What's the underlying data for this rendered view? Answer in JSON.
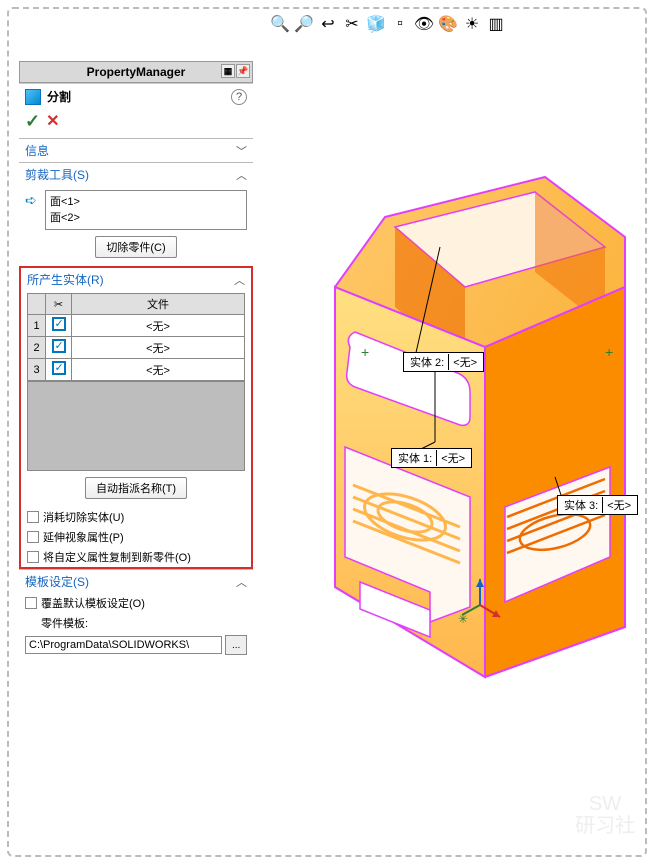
{
  "pm_title": "PropertyManager",
  "feature_name": "分割",
  "sections": {
    "info": "信息",
    "trim": "剪裁工具(S)",
    "faces": [
      "面<1>",
      "面<2>"
    ],
    "cut_btn": "切除零件(C)",
    "result": "所产生实体(R)",
    "file_col": "文件",
    "rows": [
      {
        "n": "1",
        "file": "<无>"
      },
      {
        "n": "2",
        "file": "<无>"
      },
      {
        "n": "3",
        "file": "<无>"
      }
    ],
    "auto_btn": "自动指派名称(T)",
    "opt1": "消耗切除实体(U)",
    "opt2": "延伸视象属性(P)",
    "opt3": "将自定义属性复制到新零件(O)",
    "tmpl_head": "模板设定(S)",
    "tmpl_opt": "覆盖默认模板设定(O)",
    "tmpl_lbl": "零件模板:",
    "tmpl_path": "C:\\ProgramData\\SOLIDWORKS\\"
  },
  "callouts": [
    {
      "label": "实体 2:",
      "val": "<无>"
    },
    {
      "label": "实体 1:",
      "val": "<无>"
    },
    {
      "label": "实体 3:",
      "val": "<无>"
    }
  ],
  "watermark": {
    "l1": "SW",
    "l2": "研习社"
  }
}
